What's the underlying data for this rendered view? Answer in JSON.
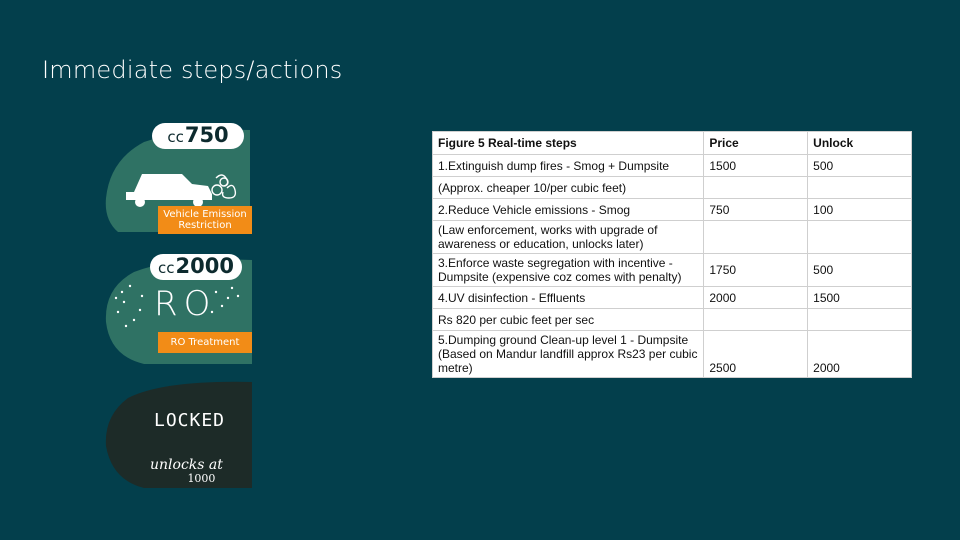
{
  "slide": {
    "title": "Immediate steps/actions"
  },
  "cards": {
    "vehicle": {
      "currency": "cc",
      "price": "750",
      "tag_line1": "Vehicle Emission",
      "tag_line2": "Restriction",
      "icon": "car-smoke-icon"
    },
    "ro": {
      "currency": "cc",
      "price": "2000",
      "center_text": "RO",
      "tag": "RO Treatment",
      "icon": "water-drops-icon"
    },
    "locked": {
      "label": "LOCKED",
      "unlock_text": "unlocks at",
      "unlock_value": "1000"
    }
  },
  "table": {
    "headers": [
      "Figure 5 Real-time steps",
      "Price",
      "Unlock"
    ],
    "rows": [
      [
        "1.Extinguish dump fires - Smog + Dumpsite",
        "1500",
        "500"
      ],
      [
        "(Approx. cheaper 10/per cubic feet)",
        "",
        ""
      ],
      [
        "2.Reduce Vehicle emissions - Smog",
        "750",
        "100"
      ],
      [
        "(Law enforcement, works with upgrade of awareness or education, unlocks later)",
        "",
        ""
      ],
      [
        "3.Enforce waste segregation with incentive - Dumpsite (expensive coz comes with penalty)",
        "1750",
        "500"
      ],
      [
        "4.UV disinfection - Effluents",
        "2000",
        "1500"
      ],
      [
        "Rs 820 per cubic feet per sec",
        "",
        ""
      ],
      [
        "5.Dumping ground Clean-up level 1 - Dumpsite (Based on Mandur landfill approx Rs23 per cubic metre)",
        "2500",
        "2000"
      ]
    ]
  },
  "colors": {
    "background": "#033f4c",
    "card_green": "#2f7264",
    "card_locked": "#1d2b28",
    "tag_orange": "#f28c17"
  }
}
